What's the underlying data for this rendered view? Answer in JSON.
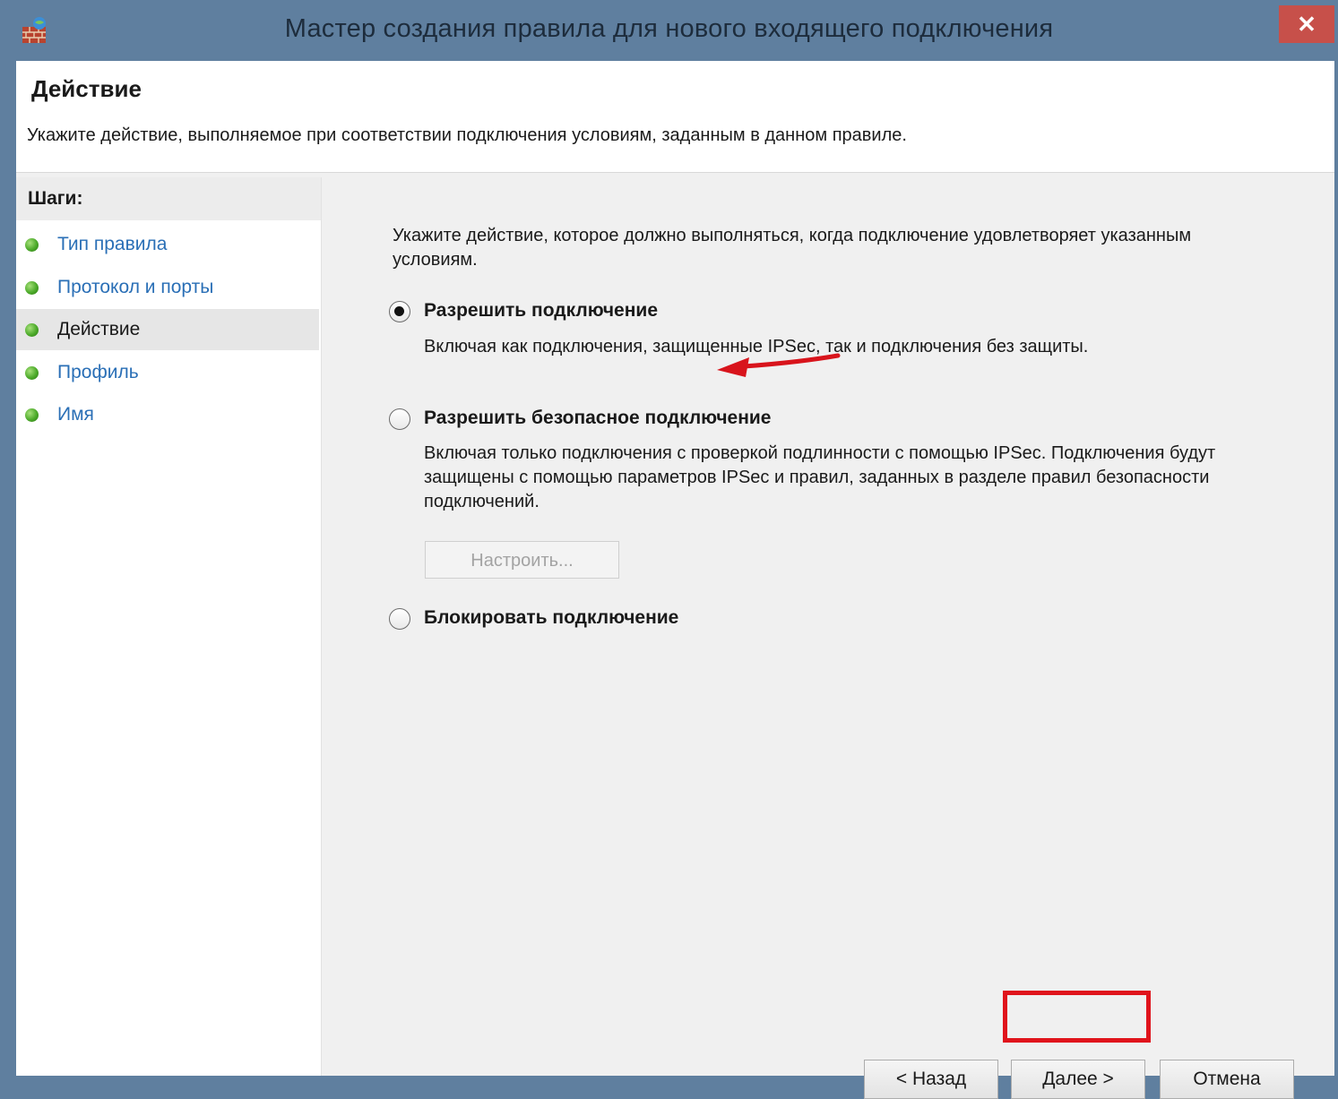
{
  "window": {
    "title": "Мастер создания правила для нового входящего подключения",
    "close_label": "✕"
  },
  "header": {
    "title": "Действие",
    "description": "Укажите действие, выполняемое при соответствии подключения условиям, заданным в данном правиле."
  },
  "steps": {
    "header": "Шаги:",
    "items": [
      {
        "label": "Тип правила",
        "active": false
      },
      {
        "label": "Протокол и порты",
        "active": false
      },
      {
        "label": "Действие",
        "active": true
      },
      {
        "label": "Профиль",
        "active": false
      },
      {
        "label": "Имя",
        "active": false
      }
    ]
  },
  "content": {
    "intro": "Укажите действие, которое должно выполняться, когда подключение удовлетворяет указанным условиям.",
    "options": [
      {
        "label": "Разрешить подключение",
        "selected": true,
        "description": "Включая как подключения, защищенные IPSec, так и подключения без защиты."
      },
      {
        "label": "Разрешить безопасное подключение",
        "selected": false,
        "description": "Включая только подключения с проверкой подлинности с помощью IPSec. Подключения будут защищены с помощью параметров IPSec и правил, заданных в разделе правил безопасности подключений."
      },
      {
        "label": "Блокировать подключение",
        "selected": false,
        "description": ""
      }
    ],
    "customize_label": "Настроить..."
  },
  "buttons": {
    "back": "< Назад",
    "next": "Далее >",
    "cancel": "Отмена"
  },
  "colors": {
    "titlebar": "#5f7f9f",
    "close": "#c7504a",
    "link": "#2a6fb6",
    "annotation": "#e0141c"
  }
}
